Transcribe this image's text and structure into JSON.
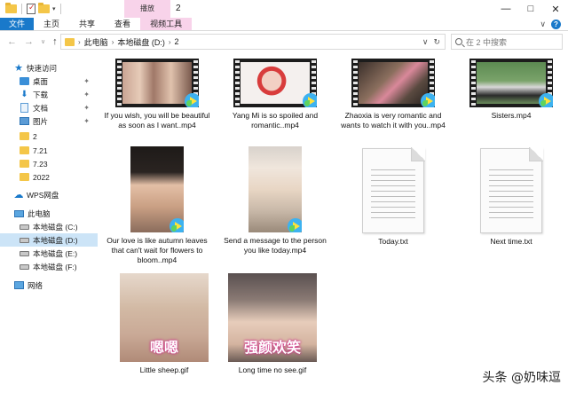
{
  "window": {
    "title": "2",
    "context_tab_group": "播放",
    "controls": [
      "—",
      "□",
      "✕"
    ]
  },
  "ribbon": {
    "tabs": [
      {
        "label": "文件",
        "kind": "file"
      },
      {
        "label": "主页",
        "kind": "normal"
      },
      {
        "label": "共享",
        "kind": "normal"
      },
      {
        "label": "查看",
        "kind": "normal"
      },
      {
        "label": "视频工具",
        "kind": "video"
      }
    ],
    "collapse_glyph": "∨",
    "help_glyph": "?"
  },
  "address": {
    "crumbs": [
      "此电脑",
      "本地磁盘 (D:)",
      "2"
    ],
    "search_placeholder": "在 2 中搜索"
  },
  "sidebar": {
    "items": [
      {
        "label": "快速访问",
        "icon": "quick-access-star-icon",
        "pinned": false
      },
      {
        "label": "桌面",
        "icon": "desktop-icon",
        "pinned": true
      },
      {
        "label": "下载",
        "icon": "download-icon",
        "pinned": true
      },
      {
        "label": "文档",
        "icon": "documents-icon",
        "pinned": true
      },
      {
        "label": "图片",
        "icon": "pictures-icon",
        "pinned": true
      },
      {
        "label": "2",
        "icon": "folder-icon",
        "pinned": false
      },
      {
        "label": "7.21",
        "icon": "folder-icon",
        "pinned": false
      },
      {
        "label": "7.23",
        "icon": "folder-icon",
        "pinned": false
      },
      {
        "label": "2022",
        "icon": "folder-icon",
        "pinned": false
      },
      {
        "label": "WPS网盘",
        "icon": "cloud-icon",
        "pinned": false
      },
      {
        "label": "此电脑",
        "icon": "pc-icon",
        "pinned": false
      },
      {
        "label": "本地磁盘 (C:)",
        "icon": "drive-icon",
        "pinned": false
      },
      {
        "label": "本地磁盘 (D:)",
        "icon": "drive-icon",
        "pinned": false,
        "selected": true
      },
      {
        "label": "本地磁盘 (E:)",
        "icon": "drive-icon",
        "pinned": false
      },
      {
        "label": "本地磁盘 (F:)",
        "icon": "drive-icon",
        "pinned": false
      },
      {
        "label": "网络",
        "icon": "network-icon",
        "pinned": false
      }
    ]
  },
  "files": [
    {
      "name": "If you wish, you will be beautiful as soon as I want..mp4",
      "type": "video"
    },
    {
      "name": "Yang Mi is so spoiled and romantic..mp4",
      "type": "video"
    },
    {
      "name": "Zhaoxia is very romantic and wants to watch it with you..mp4",
      "type": "video"
    },
    {
      "name": "Sisters.mp4",
      "type": "video"
    },
    {
      "name": "Our love is like autumn leaves that can't wait for flowers to bloom..mp4",
      "type": "video"
    },
    {
      "name": "Send a message to the person you like today.mp4",
      "type": "video"
    },
    {
      "name": "Today.txt",
      "type": "text"
    },
    {
      "name": "Next time.txt",
      "type": "text"
    },
    {
      "name": "Little sheep.gif",
      "type": "gif",
      "caption": "嗯嗯"
    },
    {
      "name": "Long time no see.gif",
      "type": "gif",
      "caption": "强颜欢笑"
    }
  ],
  "watermark": "头条 @奶味逗",
  "colors": {
    "accent": "#1979ca",
    "video_tools_tab": "#f8d3ea",
    "selection": "#cce4f7"
  }
}
